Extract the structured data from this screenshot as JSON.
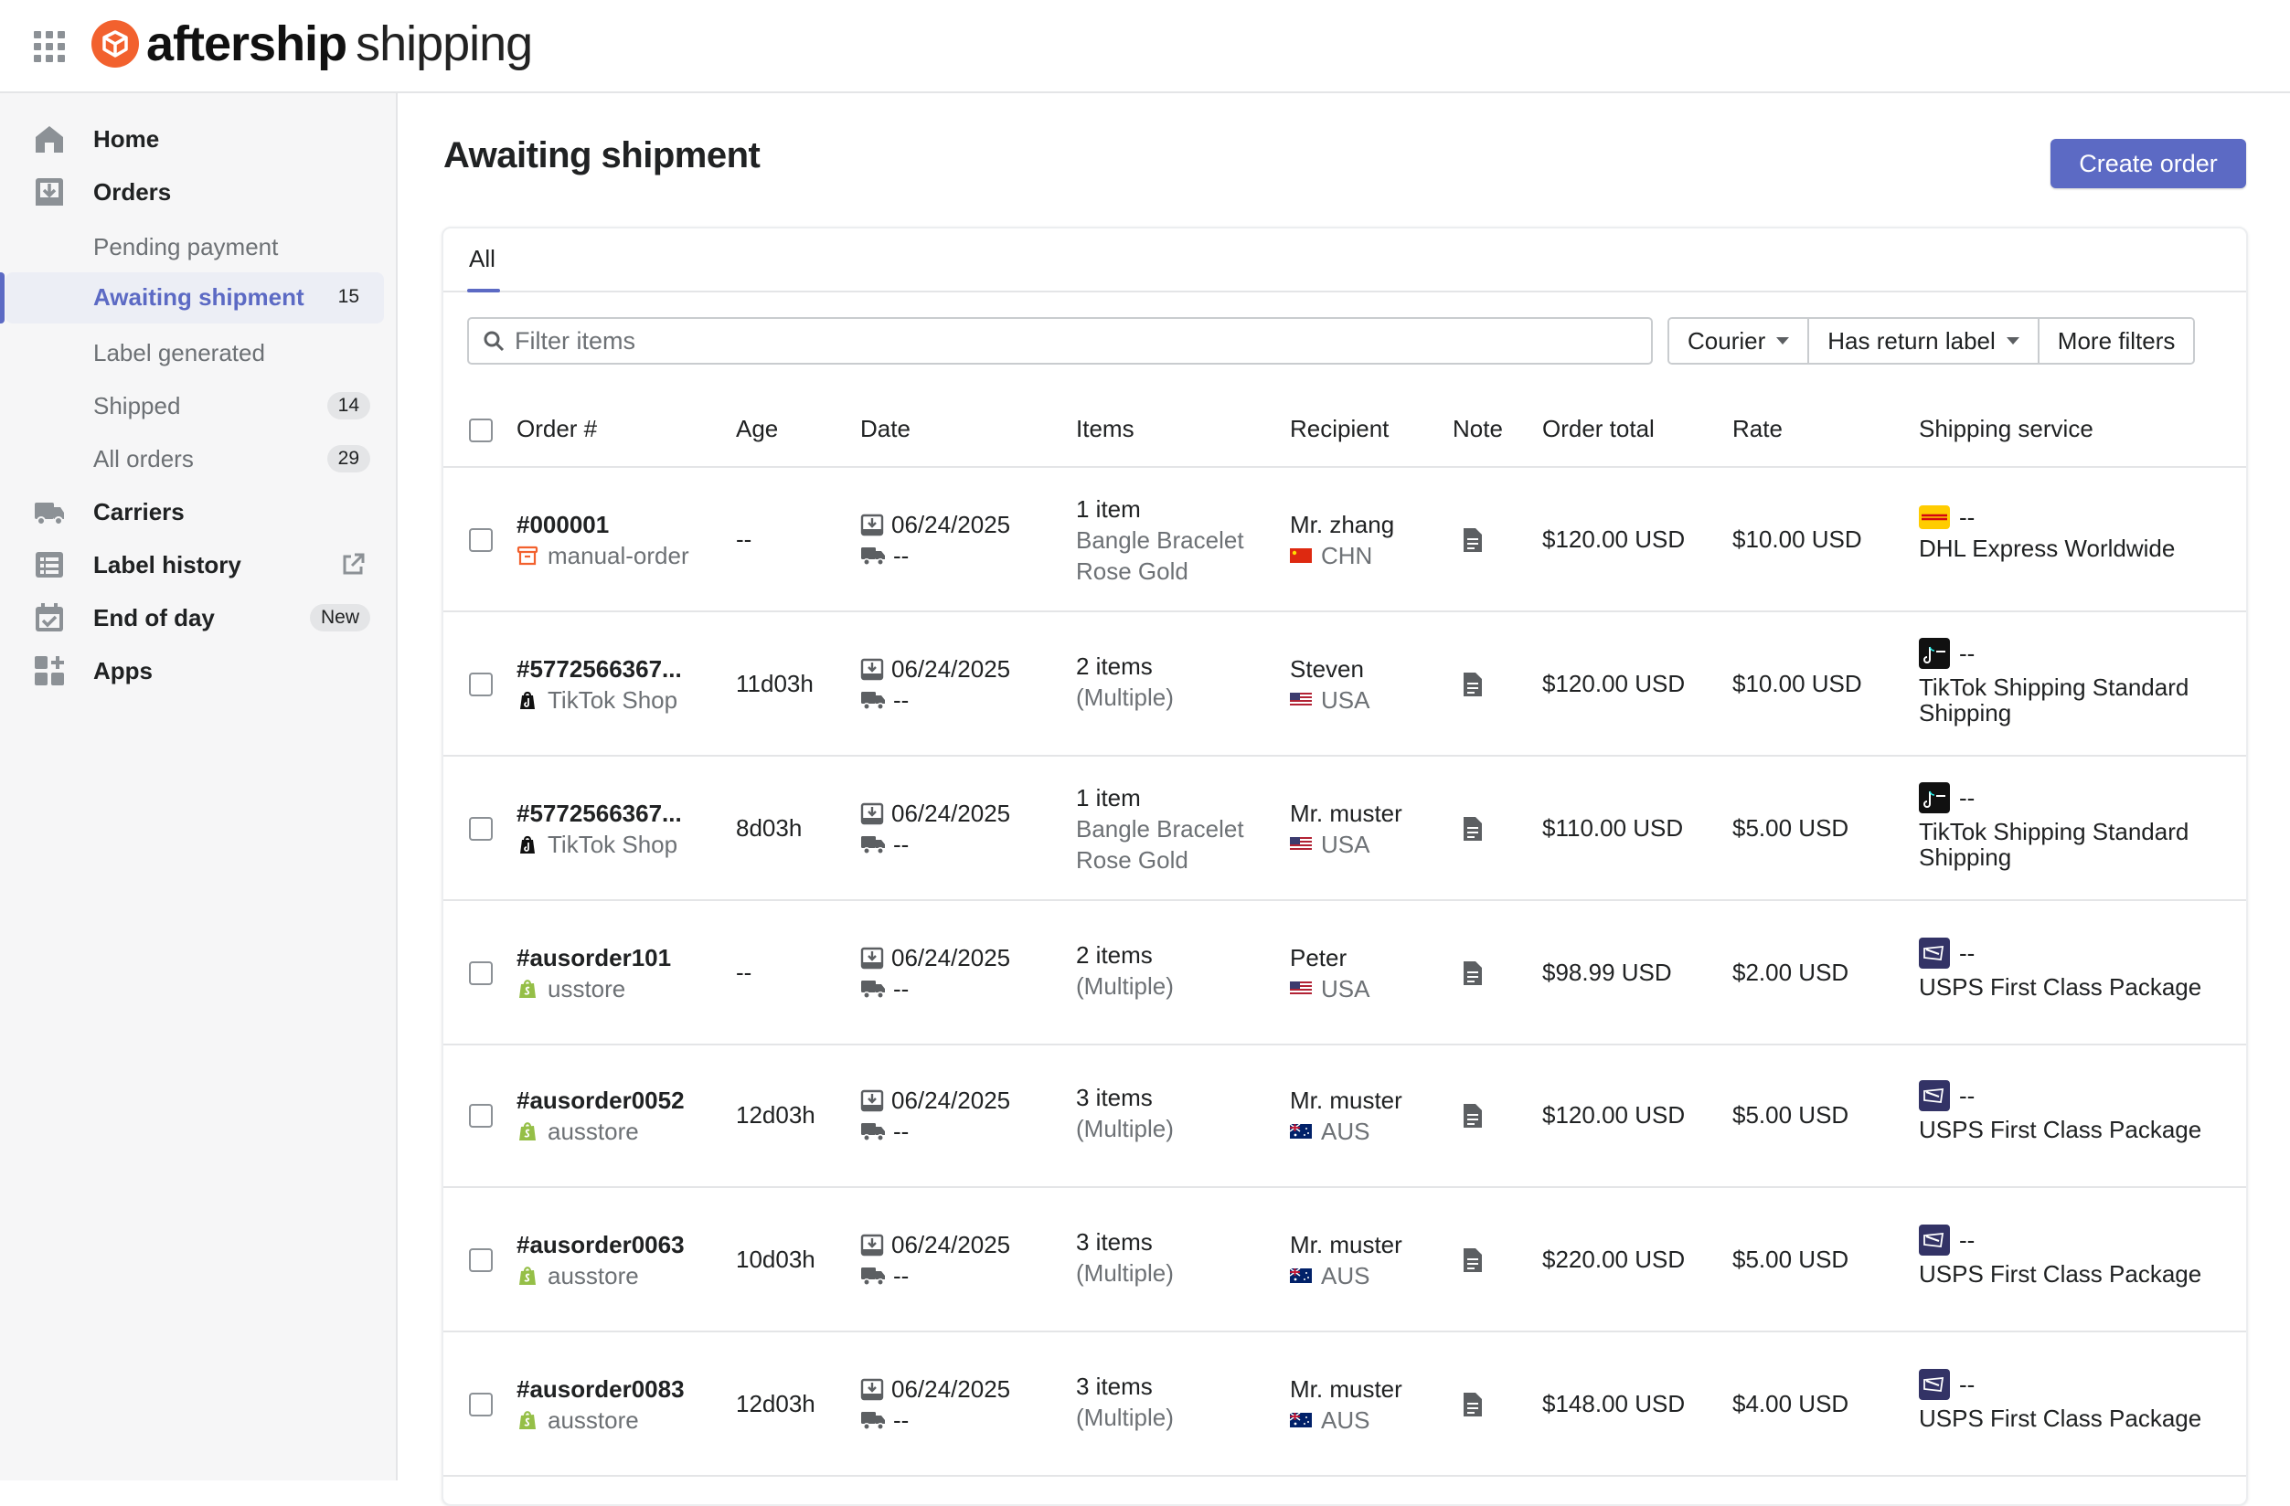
{
  "brand": {
    "bold": "aftership",
    "light": "shipping"
  },
  "sidebar": {
    "items": [
      {
        "label": "Home",
        "icon": "home-icon"
      },
      {
        "label": "Orders",
        "icon": "orders-icon"
      },
      {
        "label": "Pending payment"
      },
      {
        "label": "Awaiting shipment",
        "badge": "15"
      },
      {
        "label": "Label generated"
      },
      {
        "label": "Shipped",
        "badge": "14"
      },
      {
        "label": "All orders",
        "badge": "29"
      },
      {
        "label": "Carriers",
        "icon": "truck-icon"
      },
      {
        "label": "Label history",
        "icon": "list-icon"
      },
      {
        "label": "End of day",
        "icon": "calendar-check-icon",
        "badge": "New"
      },
      {
        "label": "Apps",
        "icon": "apps-add-icon"
      }
    ]
  },
  "page": {
    "title": "Awaiting shipment",
    "create_button": "Create order"
  },
  "tabs": [
    {
      "label": "All"
    }
  ],
  "filters": {
    "search_placeholder": "Filter items",
    "courier": "Courier",
    "return_label": "Has return label",
    "more": "More filters"
  },
  "table": {
    "columns": [
      "Order #",
      "Age",
      "Date",
      "Items",
      "Recipient",
      "Note",
      "Order total",
      "Rate",
      "Shipping service"
    ],
    "rows": [
      {
        "order": "#000001",
        "source": "manual-order",
        "source_type": "manual",
        "age": "--",
        "date": "06/24/2025",
        "ship_date": "--",
        "items_count": "1 item",
        "items_detail": [
          "Bangle Bracelet",
          "Rose Gold"
        ],
        "recipient": "Mr. zhang",
        "country": "CHN",
        "total": "$120.00 USD",
        "rate": "$10.00 USD",
        "carrier": "dhl",
        "carrier_dash": "--",
        "service": [
          "DHL Express Worldwide"
        ]
      },
      {
        "order": "#5772566367...",
        "source": "TikTok Shop",
        "source_type": "tiktok",
        "age": "11d03h",
        "date": "06/24/2025",
        "ship_date": "--",
        "items_count": "2 items",
        "items_detail": [
          "(Multiple)"
        ],
        "recipient": "Steven",
        "country": "USA",
        "total": "$120.00 USD",
        "rate": "$10.00 USD",
        "carrier": "tiktok",
        "carrier_dash": "--",
        "service": [
          "TikTok Shipping Standard",
          "Shipping"
        ]
      },
      {
        "order": "#5772566367...",
        "source": "TikTok Shop",
        "source_type": "tiktok",
        "age": "8d03h",
        "date": "06/24/2025",
        "ship_date": "--",
        "items_count": "1 item",
        "items_detail": [
          "Bangle Bracelet",
          "Rose Gold"
        ],
        "recipient": "Mr. muster",
        "country": "USA",
        "total": "$110.00 USD",
        "rate": "$5.00 USD",
        "carrier": "tiktok",
        "carrier_dash": "--",
        "service": [
          "TikTok Shipping Standard",
          "Shipping"
        ]
      },
      {
        "order": "#ausorder101",
        "source": "usstore",
        "source_type": "shopify",
        "age": "--",
        "date": "06/24/2025",
        "ship_date": "--",
        "items_count": "2 items",
        "items_detail": [
          "(Multiple)"
        ],
        "recipient": "Peter",
        "country": "USA",
        "total": "$98.99 USD",
        "rate": "$2.00 USD",
        "carrier": "usps",
        "carrier_dash": "--",
        "service": [
          "USPS First Class Package"
        ]
      },
      {
        "order": "#ausorder0052",
        "source": "ausstore",
        "source_type": "shopify",
        "age": "12d03h",
        "date": "06/24/2025",
        "ship_date": "--",
        "items_count": "3 items",
        "items_detail": [
          "(Multiple)"
        ],
        "recipient": "Mr. muster",
        "country": "AUS",
        "total": "$120.00 USD",
        "rate": "$5.00 USD",
        "carrier": "usps",
        "carrier_dash": "--",
        "service": [
          "USPS First Class Package"
        ]
      },
      {
        "order": "#ausorder0063",
        "source": "ausstore",
        "source_type": "shopify",
        "age": "10d03h",
        "date": "06/24/2025",
        "ship_date": "--",
        "items_count": "3 items",
        "items_detail": [
          "(Multiple)"
        ],
        "recipient": "Mr. muster",
        "country": "AUS",
        "total": "$220.00 USD",
        "rate": "$5.00 USD",
        "carrier": "usps",
        "carrier_dash": "--",
        "service": [
          "USPS First Class Package"
        ]
      },
      {
        "order": "#ausorder0083",
        "source": "ausstore",
        "source_type": "shopify",
        "age": "12d03h",
        "date": "06/24/2025",
        "ship_date": "--",
        "items_count": "3 items",
        "items_detail": [
          "(Multiple)"
        ],
        "recipient": "Mr. muster",
        "country": "AUS",
        "total": "$148.00 USD",
        "rate": "$4.00 USD",
        "carrier": "usps",
        "carrier_dash": "--",
        "service": [
          "USPS First Class Package"
        ]
      }
    ]
  }
}
